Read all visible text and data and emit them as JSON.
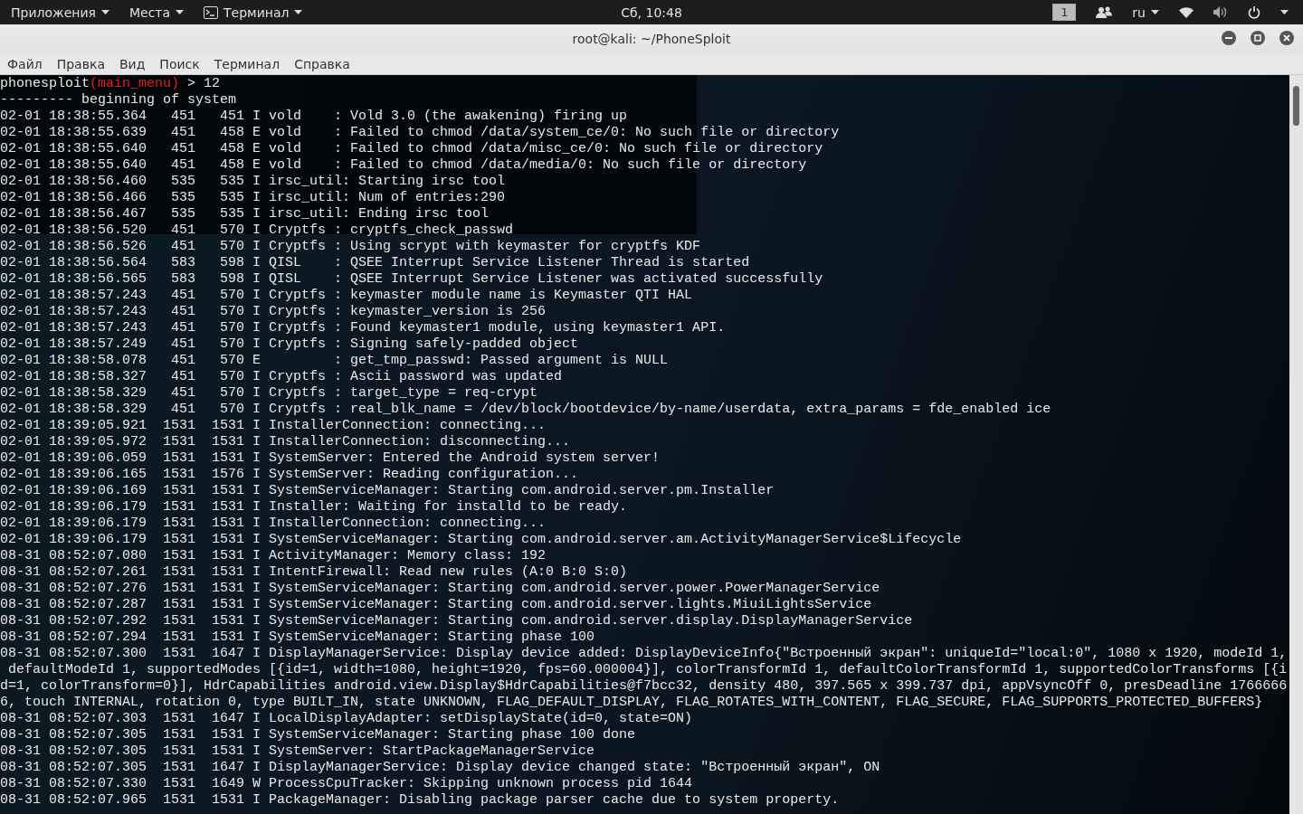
{
  "top_bar": {
    "menus": [
      {
        "label": "Приложения",
        "kind": "plain"
      },
      {
        "label": "Места",
        "kind": "plain"
      },
      {
        "label": "Терминал",
        "kind": "terminal"
      }
    ],
    "clock": "Сб, 10:48",
    "workspace": "1",
    "language": "ru"
  },
  "window": {
    "title": "root@kali: ~/PhoneSploit"
  },
  "menu_bar": [
    "Файл",
    "Правка",
    "Вид",
    "Поиск",
    "Терминал",
    "Справка"
  ],
  "terminal": {
    "prompt": {
      "name": "phonesploit",
      "context": "(main_menu)",
      "symbol": ">",
      "input": "12"
    },
    "lines": [
      "--------- beginning of system",
      "02-01 18:38:55.364   451   451 I vold    : Vold 3.0 (the awakening) firing up",
      "02-01 18:38:55.639   451   458 E vold    : Failed to chmod /data/system_ce/0: No such file or directory",
      "02-01 18:38:55.640   451   458 E vold    : Failed to chmod /data/misc_ce/0: No such file or directory",
      "02-01 18:38:55.640   451   458 E vold    : Failed to chmod /data/media/0: No such file or directory",
      "02-01 18:38:56.460   535   535 I irsc_util: Starting irsc tool",
      "02-01 18:38:56.466   535   535 I irsc_util: Num of entries:290",
      "02-01 18:38:56.467   535   535 I irsc_util: Ending irsc tool",
      "02-01 18:38:56.520   451   570 I Cryptfs : cryptfs_check_passwd",
      "02-01 18:38:56.526   451   570 I Cryptfs : Using scrypt with keymaster for cryptfs KDF",
      "02-01 18:38:56.564   583   598 I QISL    : QSEE Interrupt Service Listener Thread is started",
      "02-01 18:38:56.565   583   598 I QISL    : QSEE Interrupt Service Listener was activated successfully",
      "02-01 18:38:57.243   451   570 I Cryptfs : keymaster module name is Keymaster QTI HAL",
      "02-01 18:38:57.243   451   570 I Cryptfs : keymaster_version is 256",
      "02-01 18:38:57.243   451   570 I Cryptfs : Found keymaster1 module, using keymaster1 API.",
      "02-01 18:38:57.249   451   570 I Cryptfs : Signing safely-padded object",
      "02-01 18:38:58.078   451   570 E         : get_tmp_passwd: Passed argument is NULL",
      "02-01 18:38:58.327   451   570 I Cryptfs : Ascii password was updated",
      "02-01 18:38:58.329   451   570 I Cryptfs : target_type = req-crypt",
      "02-01 18:38:58.329   451   570 I Cryptfs : real_blk_name = /dev/block/bootdevice/by-name/userdata, extra_params = fde_enabled ice",
      "02-01 18:39:05.921  1531  1531 I InstallerConnection: connecting...",
      "02-01 18:39:05.972  1531  1531 I InstallerConnection: disconnecting...",
      "02-01 18:39:06.059  1531  1531 I SystemServer: Entered the Android system server!",
      "02-01 18:39:06.165  1531  1576 I SystemServer: Reading configuration...",
      "02-01 18:39:06.169  1531  1531 I SystemServiceManager: Starting com.android.server.pm.Installer",
      "02-01 18:39:06.179  1531  1531 I Installer: Waiting for installd to be ready.",
      "02-01 18:39:06.179  1531  1531 I InstallerConnection: connecting...",
      "02-01 18:39:06.179  1531  1531 I SystemServiceManager: Starting com.android.server.am.ActivityManagerService$Lifecycle",
      "08-31 08:52:07.080  1531  1531 I ActivityManager: Memory class: 192",
      "08-31 08:52:07.261  1531  1531 I IntentFirewall: Read new rules (A:0 B:0 S:0)",
      "08-31 08:52:07.276  1531  1531 I SystemServiceManager: Starting com.android.server.power.PowerManagerService",
      "08-31 08:52:07.287  1531  1531 I SystemServiceManager: Starting com.android.server.lights.MiuiLightsService",
      "08-31 08:52:07.292  1531  1531 I SystemServiceManager: Starting com.android.server.display.DisplayManagerService",
      "08-31 08:52:07.294  1531  1531 I SystemServiceManager: Starting phase 100",
      "08-31 08:52:07.300  1531  1647 I DisplayManagerService: Display device added: DisplayDeviceInfo{\"Встроенный экран\": uniqueId=\"local:0\", 1080 x 1920, modeId 1,",
      " defaultModeId 1, supportedModes [{id=1, width=1080, height=1920, fps=60.000004}], colorTransformId 1, defaultColorTransformId 1, supportedColorTransforms [{i",
      "d=1, colorTransform=0}], HdrCapabilities android.view.Display$HdrCapabilities@f7bcc32, density 480, 397.565 x 399.737 dpi, appVsyncOff 0, presDeadline 1766666",
      "6, touch INTERNAL, rotation 0, type BUILT_IN, state UNKNOWN, FLAG_DEFAULT_DISPLAY, FLAG_ROTATES_WITH_CONTENT, FLAG_SECURE, FLAG_SUPPORTS_PROTECTED_BUFFERS}",
      "08-31 08:52:07.303  1531  1647 I LocalDisplayAdapter: setDisplayState(id=0, state=ON)",
      "08-31 08:52:07.305  1531  1531 I SystemServiceManager: Starting phase 100 done",
      "08-31 08:52:07.305  1531  1531 I SystemServer: StartPackageManagerService",
      "08-31 08:52:07.305  1531  1647 I DisplayManagerService: Display device changed state: \"Встроенный экран\", ON",
      "08-31 08:52:07.330  1531  1649 W ProcessCpuTracker: Skipping unknown process pid 1644",
      "08-31 08:52:07.965  1531  1531 I PackageManager: Disabling package parser cache due to system property."
    ]
  }
}
